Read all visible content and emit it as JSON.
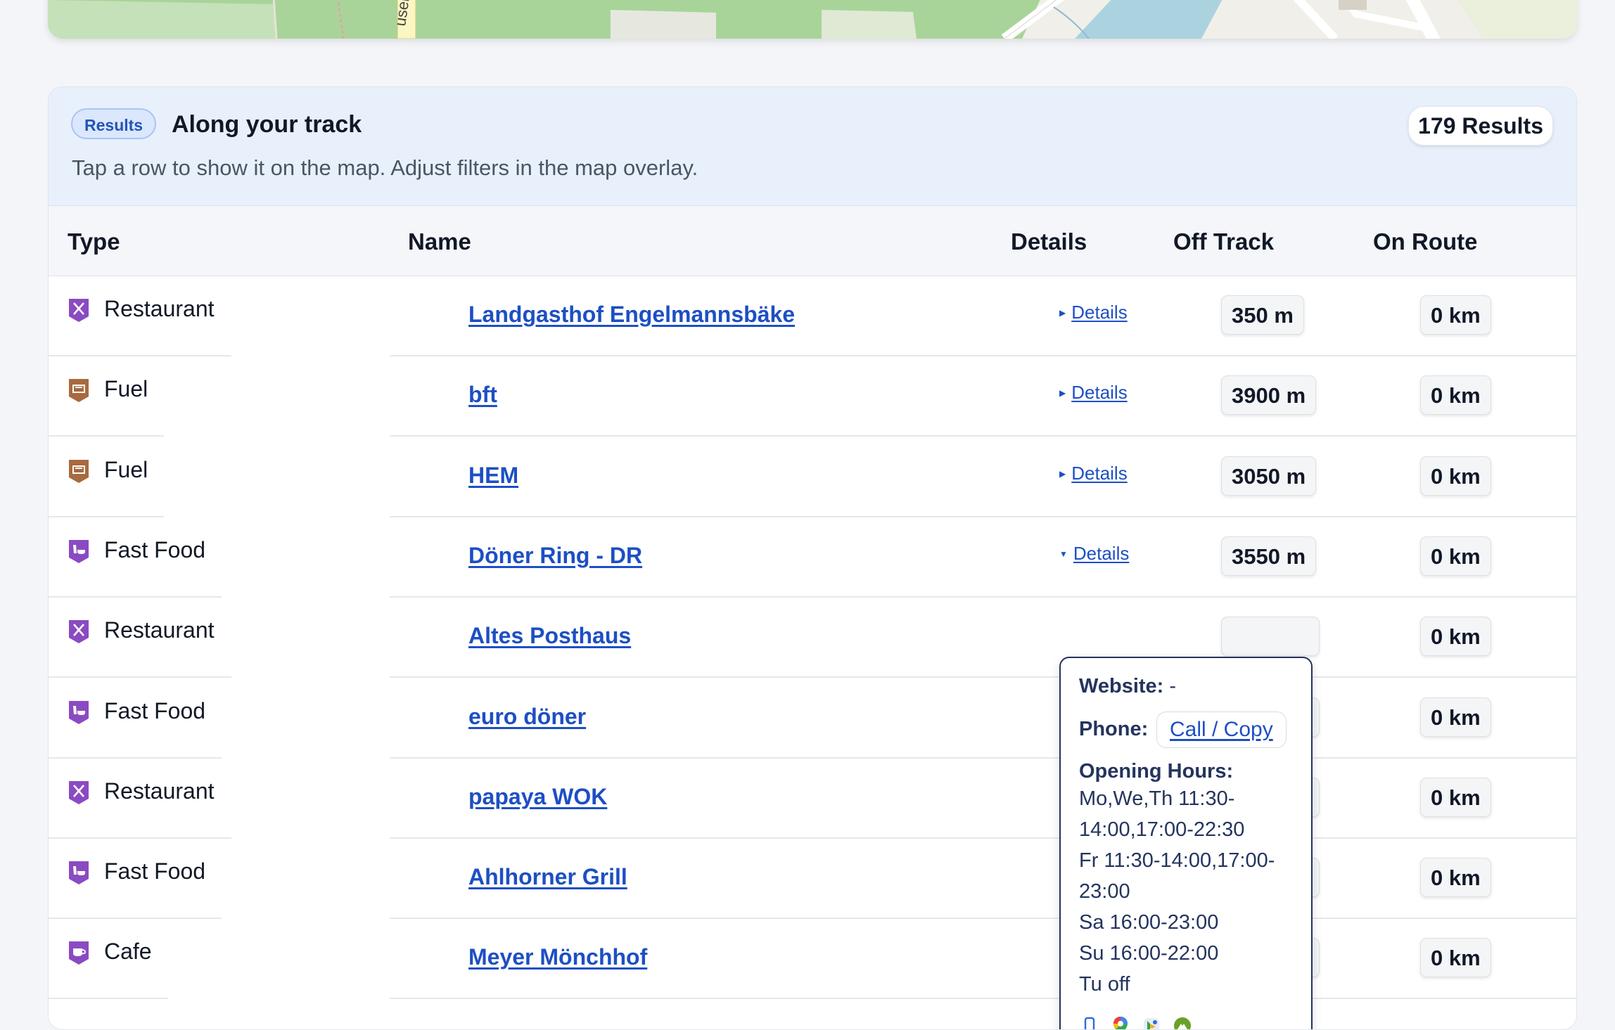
{
  "map": {
    "road_label": "user"
  },
  "results": {
    "badge": "Results",
    "title": "Along your track",
    "subtitle": "Tap a row to show it on the map. Adjust filters in the map overlay.",
    "count": "179 Results"
  },
  "table": {
    "headers": {
      "type": "Type",
      "name": "Name",
      "details": "Details",
      "off_track": "Off Track",
      "on_route": "On Route"
    },
    "rows": [
      {
        "type": "Restaurant",
        "icon": "restaurant-icon",
        "name": "Landgasthof Engelmannsbäke",
        "details": "Details",
        "off_track": "350 m",
        "on_route": "0 km"
      },
      {
        "type": "Fuel",
        "icon": "fuel-icon",
        "name": "bft",
        "details": "Details",
        "off_track": "3900 m",
        "on_route": "0 km"
      },
      {
        "type": "Fuel",
        "icon": "fuel-icon",
        "name": "HEM",
        "details": "Details",
        "off_track": "3050 m",
        "on_route": "0 km"
      },
      {
        "type": "Fast Food",
        "icon": "fast-food-icon",
        "name": "Döner Ring - DR",
        "details": "Details",
        "off_track": "3550 m",
        "on_route": "0 km"
      },
      {
        "type": "Restaurant",
        "icon": "restaurant-icon",
        "name": "Altes Posthaus",
        "details": "",
        "off_track": "",
        "on_route": "0 km"
      },
      {
        "type": "Fast Food",
        "icon": "fast-food-icon",
        "name": "euro döner",
        "details": "",
        "off_track": "",
        "on_route": "0 km"
      },
      {
        "type": "Restaurant",
        "icon": "restaurant-icon",
        "name": "papaya WOK",
        "details": "",
        "off_track": "",
        "on_route": "0 km"
      },
      {
        "type": "Fast Food",
        "icon": "fast-food-icon",
        "name": "Ahlhorner Grill",
        "details": "",
        "off_track": "",
        "on_route": "0 km"
      },
      {
        "type": "Cafe",
        "icon": "cafe-icon",
        "name": "Meyer Mönchhof",
        "details": "",
        "off_track": "",
        "on_route": "0 km"
      }
    ]
  },
  "popover": {
    "website_label": "Website:",
    "website_value": "-",
    "phone_label": "Phone:",
    "phone_action": "Call / Copy",
    "hours_label": "Opening Hours:",
    "hours_lines": [
      "Mo,We,Th 11:30-",
      "14:00,17:00-22:30",
      "Fr 11:30-14:00,17:00-",
      "23:00",
      "Sa 16:00-23:00",
      "Su 16:00-22:00",
      "Tu off"
    ],
    "apps": [
      "apple-maps-icon",
      "google-maps-icon",
      "bing-maps-icon",
      "komoot-icon"
    ]
  },
  "colors": {
    "link": "#1d4fc4",
    "header_bg": "#e8f0fc",
    "badge_bg": "#dbe7fc",
    "food_icon": "#8a4bc2",
    "fuel_icon": "#a86a3e"
  }
}
